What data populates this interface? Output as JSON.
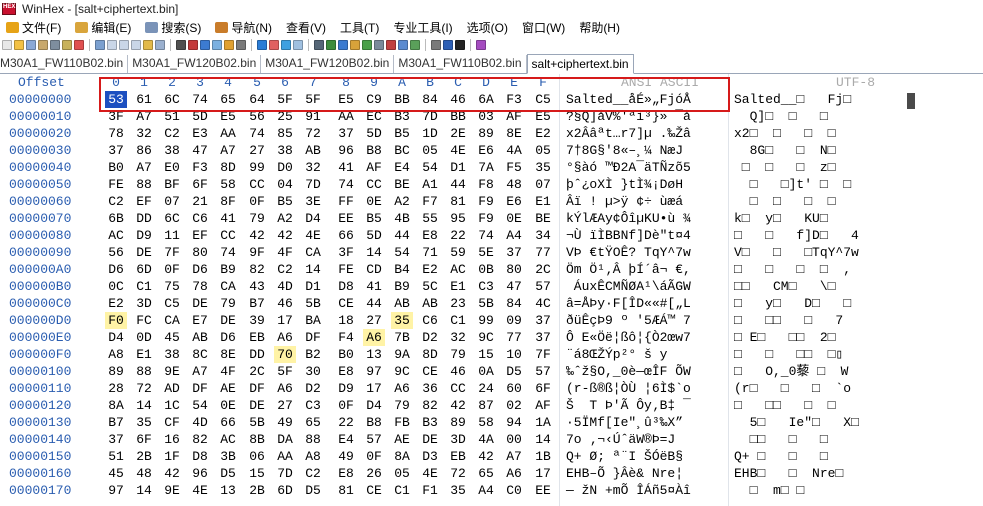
{
  "window": {
    "title": "WinHex - [salt+ciphertext.bin]",
    "app_icon_text": "HEX"
  },
  "menu": [
    {
      "label": "文件(F)",
      "icon": "file-icon",
      "color": "#e6a317"
    },
    {
      "label": "编辑(E)",
      "icon": "edit-icon",
      "color": "#d9a53c"
    },
    {
      "label": "搜索(S)",
      "icon": "search-icon",
      "color": "#7a93b8"
    },
    {
      "label": "导航(N)",
      "icon": "navigate-icon",
      "color": "#c97c2a"
    },
    {
      "label": "查看(V)",
      "icon": "view-icon",
      "color": ""
    },
    {
      "label": "工具(T)",
      "icon": "tools-icon",
      "color": ""
    },
    {
      "label": "专业工具(I)",
      "icon": "pro-tools-icon",
      "color": ""
    },
    {
      "label": "选项(O)",
      "icon": "options-icon",
      "color": ""
    },
    {
      "label": "窗口(W)",
      "icon": "window-icon",
      "color": ""
    },
    {
      "label": "帮助(H)",
      "icon": "help-icon",
      "color": ""
    }
  ],
  "toolbar_groups": [
    [
      "#e8e8e8",
      "#f3c145",
      "#8aa8d6",
      "#c8a86b",
      "#7e8e9e",
      "#c8b25a",
      "#e05050"
    ],
    [
      "#7ba0d0",
      "#c9d6e8",
      "#c9d6e8",
      "#c9d6e8",
      "#e2b94a",
      "#9ab0cf"
    ],
    [
      "#505050",
      "#c43a3a",
      "#3c7bd1",
      "#7bb0e0",
      "#e0a030",
      "#7a7a7a"
    ],
    [
      "#2a7cd6",
      "#e06060",
      "#3fa0e0",
      "#a0c0e0"
    ],
    [
      "#556677",
      "#3c8c3c",
      "#3a7ad0",
      "#d8a23a",
      "#4aa04a",
      "#7a8a9a",
      "#c04040",
      "#5a8ad0",
      "#5aa05a"
    ],
    [
      "#7a7a7a",
      "#2d5fb5",
      "#222222"
    ],
    [
      "#a54cc0"
    ]
  ],
  "tabs": [
    {
      "label": "M30A1_FW110B02.bin",
      "active": false
    },
    {
      "label": "M30A1_FW120B02.bin",
      "active": false
    },
    {
      "label": "M30A1_FW120B02.bin",
      "active": false
    },
    {
      "label": "M30A1_FW110B02.bin",
      "active": false
    },
    {
      "label": "salt+ciphertext.bin",
      "active": true
    }
  ],
  "hex_view": {
    "offset_header": "Offset",
    "column_headers": [
      "0",
      "1",
      "2",
      "3",
      "4",
      "5",
      "6",
      "7",
      "8",
      "9",
      "A",
      "B",
      "C",
      "D",
      "E",
      "F"
    ],
    "ansi_header": "ANSI ASCII",
    "utf_header": "UTF-8",
    "rows": [
      {
        "offset": "00000000",
        "bytes": [
          "53",
          "61",
          "6C",
          "74",
          "65",
          "64",
          "5F",
          "5F",
          "E5",
          "C9",
          "BB",
          "84",
          "46",
          "6A",
          "F3",
          "C5"
        ],
        "ansi": "Salted__åÉ»„FjóÅ",
        "utf8": "Salted__□   Fj□"
      },
      {
        "offset": "00000010",
        "bytes": [
          "3F",
          "A7",
          "51",
          "5D",
          "E5",
          "56",
          "25",
          "91",
          "AA",
          "EC",
          "B3",
          "7D",
          "BB",
          "03",
          "AF",
          "E5"
        ],
        "ansi": "?§Q]åV%'ªì³}» ¯å",
        "utf8": "  Q]□  □   □"
      },
      {
        "offset": "00000020",
        "bytes": [
          "78",
          "32",
          "C2",
          "E3",
          "AA",
          "74",
          "85",
          "72",
          "37",
          "5D",
          "B5",
          "1D",
          "2E",
          "89",
          "8E",
          "E2"
        ],
        "ansi": "x2Ââªt…r7]µ .‰Žâ",
        "utf8": "x2□  □   □  □"
      },
      {
        "offset": "00000030",
        "bytes": [
          "37",
          "86",
          "38",
          "47",
          "A7",
          "27",
          "38",
          "AB",
          "96",
          "B8",
          "BC",
          "05",
          "4E",
          "E6",
          "4A",
          "05"
        ],
        "ansi": "7†8G§'8«–¸¼ NæJ ",
        "utf8": "  8G□   □  N□"
      },
      {
        "offset": "00000040",
        "bytes": [
          "B0",
          "A7",
          "E0",
          "F3",
          "8D",
          "99",
          "D0",
          "32",
          "41",
          "AF",
          "E4",
          "54",
          "D1",
          "7A",
          "F5",
          "35"
        ],
        "ansi": "°§àó ™Ð2A¯äTÑzõ5",
        "utf8": " □  □   □  z□"
      },
      {
        "offset": "00000050",
        "bytes": [
          "FE",
          "88",
          "BF",
          "6F",
          "58",
          "CC",
          "04",
          "7D",
          "74",
          "CC",
          "BE",
          "A1",
          "44",
          "F8",
          "48",
          "07"
        ],
        "ansi": "þˆ¿oXÌ }tÌ¾¡DøH ",
        "utf8": "  □   □]t' □  □"
      },
      {
        "offset": "00000060",
        "bytes": [
          "C2",
          "EF",
          "07",
          "21",
          "8F",
          "0F",
          "B5",
          "3E",
          "FF",
          "0E",
          "A2",
          "F7",
          "81",
          "F9",
          "E6",
          "E1"
        ],
        "ansi": "Âï ! µ>ÿ ¢÷ ùæá",
        "utf8": "  □  □   □  □"
      },
      {
        "offset": "00000070",
        "bytes": [
          "6B",
          "DD",
          "6C",
          "C6",
          "41",
          "79",
          "A2",
          "D4",
          "EE",
          "B5",
          "4B",
          "55",
          "95",
          "F9",
          "0E",
          "BE"
        ],
        "ansi": "kÝlÆAy¢ÔîµKU•ù ¾",
        "utf8": "k□  y□   KU□"
      },
      {
        "offset": "00000080",
        "bytes": [
          "AC",
          "D9",
          "11",
          "EF",
          "CC",
          "42",
          "42",
          "4E",
          "66",
          "5D",
          "44",
          "E8",
          "22",
          "74",
          "A4",
          "34"
        ],
        "ansi": "¬Ù ïÌBBNf]Dè\"t¤4",
        "utf8": "□   □   f]D□   4"
      },
      {
        "offset": "00000090",
        "bytes": [
          "56",
          "DE",
          "7F",
          "80",
          "74",
          "9F",
          "4F",
          "CA",
          "3F",
          "14",
          "54",
          "71",
          "59",
          "5E",
          "37",
          "77"
        ],
        "ansi": "VÞ €tŸOÊ? TqY^7w",
        "utf8": "V□   □   □TqY^7w"
      },
      {
        "offset": "000000A0",
        "bytes": [
          "D6",
          "6D",
          "0F",
          "D6",
          "B9",
          "82",
          "C2",
          "14",
          "FE",
          "CD",
          "B4",
          "E2",
          "AC",
          "0B",
          "80",
          "2C"
        ],
        "ansi": "Öm Ö¹‚Â þÍ´â¬ €,",
        "utf8": "□   □   □  □  ,"
      },
      {
        "offset": "000000B0",
        "bytes": [
          "0C",
          "C1",
          "75",
          "78",
          "CA",
          "43",
          "4D",
          "D1",
          "D8",
          "41",
          "B9",
          "5C",
          "E1",
          "C3",
          "47",
          "57"
        ],
        "ansi": " ÁuxÊCMÑØA¹\\áÃGW",
        "utf8": "□□   CM□   \\□"
      },
      {
        "offset": "000000C0",
        "bytes": [
          "E2",
          "3D",
          "C5",
          "DE",
          "79",
          "B7",
          "46",
          "5B",
          "CE",
          "44",
          "AB",
          "AB",
          "23",
          "5B",
          "84",
          "4C"
        ],
        "ansi": "â=ÅÞy·F[ÎD««#[„L",
        "utf8": "□   y□   D□   □"
      },
      {
        "offset": "000000D0",
        "bytes": [
          "F0",
          "FC",
          "CA",
          "E7",
          "DE",
          "39",
          "17",
          "BA",
          "18",
          "27",
          "35",
          "C6",
          "C1",
          "99",
          "09",
          "37"
        ],
        "ansi": "ðüÊçÞ9 º '5ÆÁ™ 7",
        "utf8": "□   □□   □   7"
      },
      {
        "offset": "000000E0",
        "bytes": [
          "D4",
          "0D",
          "45",
          "AB",
          "D6",
          "EB",
          "A6",
          "DF",
          "F4",
          "A6",
          "7B",
          "D2",
          "32",
          "9C",
          "77",
          "37"
        ],
        "ansi": "Ô E«Öë¦ßô¦{Ò2œw7",
        "utf8": "□ E□   □□  2□"
      },
      {
        "offset": "000000F0",
        "bytes": [
          "A8",
          "E1",
          "38",
          "8C",
          "8E",
          "DD",
          "70",
          "B2",
          "B0",
          "13",
          "9A",
          "8D",
          "79",
          "15",
          "10",
          "7F"
        ],
        "ansi": "¨á8ŒŽÝp²° š y   ",
        "utf8": "□   □   □□  □▯"
      },
      {
        "offset": "00000100",
        "bytes": [
          "89",
          "88",
          "9E",
          "A7",
          "4F",
          "2C",
          "5F",
          "30",
          "E8",
          "97",
          "9C",
          "CE",
          "46",
          "0A",
          "D5",
          "57"
        ],
        "ansi": "‰ˆž§O,_0è—œÎF ÕW",
        "utf8": "□   O,_0藜 □  W"
      },
      {
        "offset": "00000110",
        "bytes": [
          "28",
          "72",
          "AD",
          "DF",
          "AE",
          "DF",
          "A6",
          "D2",
          "D9",
          "17",
          "A6",
          "36",
          "CC",
          "24",
          "60",
          "6F"
        ],
        "ansi": "(r-ß®ß¦ÒÙ ¦6Ì$`o",
        "utf8": "(r□   □   □  `o"
      },
      {
        "offset": "00000120",
        "bytes": [
          "8A",
          "14",
          "1C",
          "54",
          "0E",
          "DE",
          "27",
          "C3",
          "0F",
          "D4",
          "79",
          "82",
          "42",
          "87",
          "02",
          "AF"
        ],
        "ansi": "Š  T Þ'Ã Ôy‚B‡ ¯",
        "utf8": "□   □□   □  □"
      },
      {
        "offset": "00000130",
        "bytes": [
          "B7",
          "35",
          "CF",
          "4D",
          "66",
          "5B",
          "49",
          "65",
          "22",
          "B8",
          "FB",
          "B3",
          "89",
          "58",
          "94",
          "1A"
        ],
        "ansi": "·5ÏMf[Ie\"¸û³‰X” ",
        "utf8": "  5□   Ie\"□   X□"
      },
      {
        "offset": "00000140",
        "bytes": [
          "37",
          "6F",
          "16",
          "82",
          "AC",
          "8B",
          "DA",
          "88",
          "E4",
          "57",
          "AE",
          "DE",
          "3D",
          "4A",
          "00",
          "14"
        ],
        "ansi": "7o ‚¬‹ÚˆäW®Þ=J  ",
        "utf8": "  □□   □   □"
      },
      {
        "offset": "00000150",
        "bytes": [
          "51",
          "2B",
          "1F",
          "D8",
          "3B",
          "06",
          "AA",
          "A8",
          "49",
          "0F",
          "8A",
          "D3",
          "EB",
          "42",
          "A7",
          "1B"
        ],
        "ansi": "Q+ Ø; ª¨I ŠÓëB§ ",
        "utf8": "Q+ □   □   □"
      },
      {
        "offset": "00000160",
        "bytes": [
          "45",
          "48",
          "42",
          "96",
          "D5",
          "15",
          "7D",
          "C2",
          "E8",
          "26",
          "05",
          "4E",
          "72",
          "65",
          "A6",
          "17"
        ],
        "ansi": "EHB–Õ }Âè& Nre¦ ",
        "utf8": "EHB□   □  Nre□"
      },
      {
        "offset": "00000170",
        "bytes": [
          "97",
          "14",
          "9E",
          "4E",
          "13",
          "2B",
          "6D",
          "D5",
          "81",
          "CE",
          "C1",
          "F1",
          "35",
          "A4",
          "C0",
          "EE"
        ],
        "ansi": "— žN +mÕ ÎÁñ5¤Àî",
        "utf8": "  □  m□ □"
      }
    ],
    "highlights": [
      {
        "row": 13,
        "col": 0
      },
      {
        "row": 13,
        "col": 10
      },
      {
        "row": 14,
        "col": 9
      },
      {
        "row": 15,
        "col": 6
      }
    ],
    "cursor": {
      "row": 0,
      "col": 0
    }
  }
}
